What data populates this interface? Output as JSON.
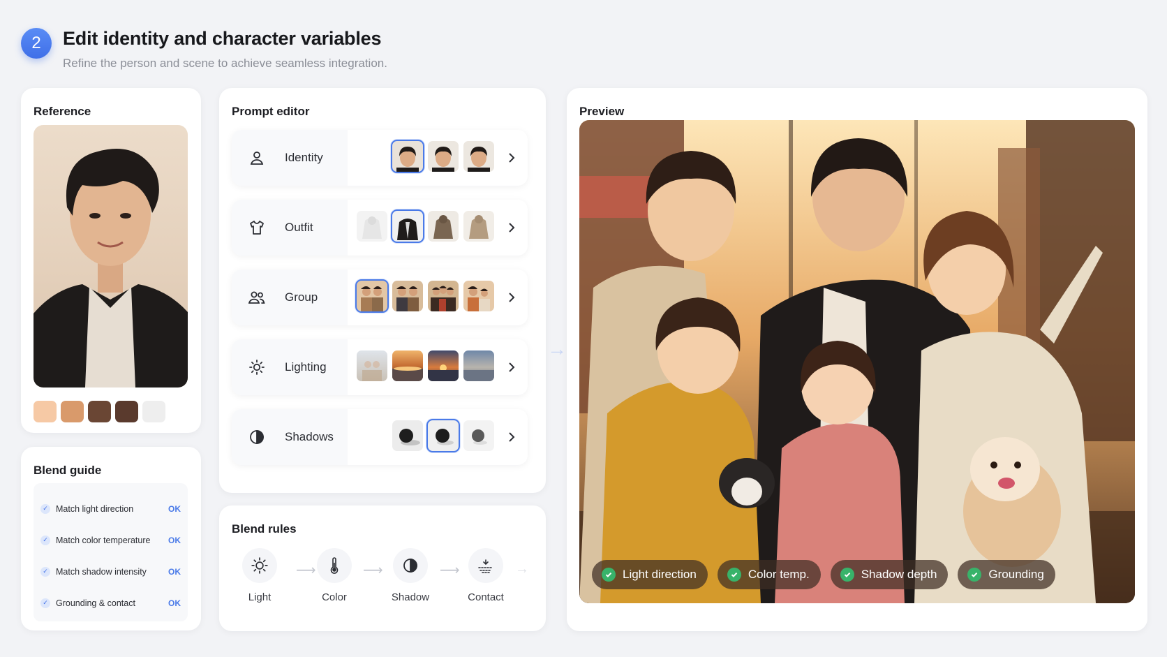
{
  "header": {
    "step": "2",
    "title": "Edit identity and character variables",
    "subtitle": "Refine the person and scene to achieve seamless integration."
  },
  "reference": {
    "title": "Reference",
    "swatches": [
      "#f6c9a5",
      "#d99a6b",
      "#6a4634",
      "#5a3a2d",
      "#eeeeee"
    ]
  },
  "blend_guide": {
    "title": "Blend guide",
    "items": [
      {
        "label": "Match light direction",
        "status": "OK"
      },
      {
        "label": "Match color temperature",
        "status": "OK"
      },
      {
        "label": "Match shadow intensity",
        "status": "OK"
      },
      {
        "label": "Grounding & contact",
        "status": "OK"
      }
    ]
  },
  "prompt_editor": {
    "title": "Prompt editor",
    "rows": [
      {
        "label": "Identity",
        "icon": "person-icon"
      },
      {
        "label": "Outfit",
        "icon": "shirt-icon"
      },
      {
        "label": "Group",
        "icon": "people-icon"
      },
      {
        "label": "Lighting",
        "icon": "sun-icon"
      },
      {
        "label": "Shadows",
        "icon": "contrast-icon"
      }
    ]
  },
  "blend_rules": {
    "title": "Blend rules",
    "steps": [
      {
        "label": "Light",
        "icon": "sun-icon"
      },
      {
        "label": "Color",
        "icon": "thermometer-icon"
      },
      {
        "label": "Shadow",
        "icon": "contrast-icon"
      },
      {
        "label": "Contact",
        "icon": "ground-contact-icon"
      }
    ]
  },
  "preview": {
    "title": "Preview",
    "chips": [
      "Light direction",
      "Color temp.",
      "Shadow depth",
      "Grounding"
    ]
  },
  "colors": {
    "accent": "#4a7ae8",
    "check_green": "#38b36a"
  }
}
